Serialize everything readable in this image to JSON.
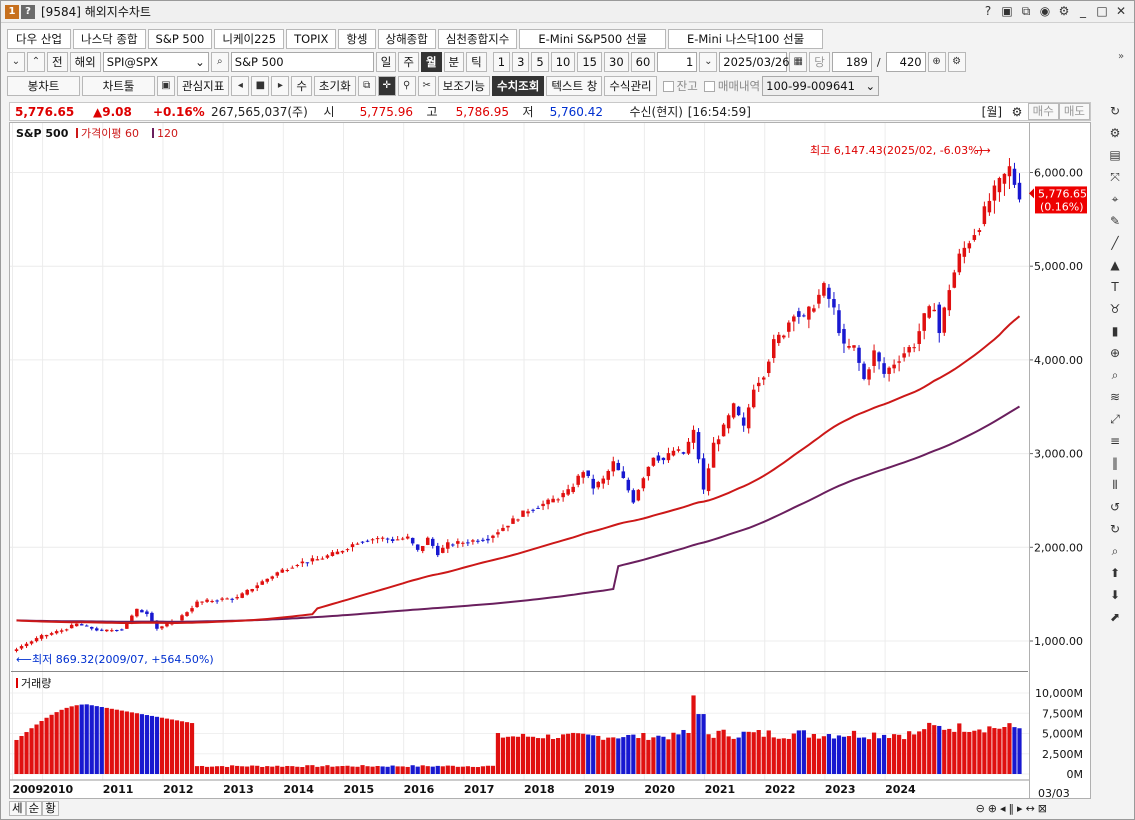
{
  "window": {
    "badge1": "1",
    "badge2": "?",
    "title": "[9584] 해외지수차트",
    "controls": [
      "?",
      "▣",
      "⧉",
      "⚙",
      "⚙",
      "_",
      "□",
      "✕"
    ]
  },
  "index_tabs": [
    "다우 산업",
    "나스닥 종합",
    "S&P 500",
    "니케이225",
    "TOPIX",
    "항셍",
    "상해종합",
    "심천종합지수",
    "E-Mini S&P500 선물",
    "E-Mini 나스닥100 선물"
  ],
  "toolbar1": {
    "prev": "전",
    "region": "해외",
    "symbol": "SPI@SPX",
    "name": "S&P 500",
    "periods": [
      "일",
      "주",
      "월",
      "분",
      "틱"
    ],
    "active_period": "월",
    "minutes": [
      "1",
      "3",
      "5",
      "10",
      "15",
      "30",
      "60"
    ],
    "interval": "1",
    "date": "2025/03/26",
    "dang": "당",
    "count": "189",
    "slash": "/",
    "total": "420"
  },
  "toolbar2": {
    "candle": "봉차트",
    "charttools": "차트툴",
    "indicator": "관심지표",
    "su": "수",
    "reset": "초기화",
    "aux": "보조기능",
    "value_lookup": "수치조회",
    "text_window": "텍스트 창",
    "formula": "수식관리",
    "balance": "잔고",
    "trade_history": "매매내역",
    "account": "100-99-009641"
  },
  "quote": {
    "price": "5,776.65",
    "change": "▲9.08",
    "pct": "+0.16%",
    "volume": "267,565,037(주)",
    "open_label": "시",
    "open": "5,775.96",
    "high_label": "고",
    "high": "5,786.95",
    "low_label": "저",
    "low": "5,760.42",
    "receive": "수신(현지)",
    "time": "[16:54:59]",
    "month_label": "[월]",
    "buy": "매수",
    "sell": "매도"
  },
  "chart_data": {
    "type": "candlestick",
    "title": "S&P 500",
    "legend": [
      "가격이평 60",
      "120"
    ],
    "colors": {
      "up": "#e01010",
      "down": "#1818d0",
      "ma60": "#cc1818",
      "ma120": "#6a1f5e"
    },
    "years": [
      "2009",
      "2010",
      "2011",
      "2012",
      "2013",
      "2014",
      "2015",
      "2016",
      "2017",
      "2018",
      "2019",
      "2020",
      "2021",
      "2022",
      "2023",
      "2024"
    ],
    "y_ticks": [
      "1,000.00",
      "2,000.00",
      "3,000.00",
      "4,000.00",
      "5,000.00",
      "6,000.00"
    ],
    "ylim": [
      870,
      6150
    ],
    "volume_ticks": [
      "0M",
      "2,500M",
      "5,000M",
      "7,500M",
      "10,000M"
    ],
    "high_annotation": "최고 6,147.43(2025/02, -6.03%)",
    "low_annotation": "최저 869.32(2009/07, +564.50%)",
    "last_price": "5,776.65",
    "last_pct": "(0.16%)",
    "volume_title": "거래량",
    "last_date": "03/03",
    "anchors": [
      [
        0,
        920
      ],
      [
        5,
        1050
      ],
      [
        9,
        1115
      ],
      [
        12,
        1180
      ],
      [
        17,
        1105
      ],
      [
        21,
        1130
      ],
      [
        24,
        1330
      ],
      [
        26,
        1300
      ],
      [
        28,
        1135
      ],
      [
        32,
        1220
      ],
      [
        36,
        1410
      ],
      [
        40,
        1440
      ],
      [
        44,
        1460
      ],
      [
        48,
        1600
      ],
      [
        52,
        1730
      ],
      [
        56,
        1830
      ],
      [
        60,
        1870
      ],
      [
        64,
        1945
      ],
      [
        68,
        2060
      ],
      [
        72,
        2100
      ],
      [
        75,
        2080
      ],
      [
        78,
        2100
      ],
      [
        80,
        1960
      ],
      [
        82,
        2090
      ],
      [
        84,
        1940
      ],
      [
        86,
        2030
      ],
      [
        90,
        2060
      ],
      [
        94,
        2100
      ],
      [
        98,
        2250
      ],
      [
        102,
        2400
      ],
      [
        106,
        2480
      ],
      [
        110,
        2590
      ],
      [
        113,
        2820
      ],
      [
        115,
        2640
      ],
      [
        117,
        2720
      ],
      [
        119,
        2900
      ],
      [
        121,
        2720
      ],
      [
        123,
        2500
      ],
      [
        125,
        2760
      ],
      [
        127,
        2980
      ],
      [
        129,
        2930
      ],
      [
        131,
        3030
      ],
      [
        133,
        3000
      ],
      [
        135,
        3230
      ],
      [
        136,
        2950
      ],
      [
        137,
        2600
      ],
      [
        139,
        3100
      ],
      [
        141,
        3270
      ],
      [
        143,
        3500
      ],
      [
        145,
        3270
      ],
      [
        147,
        3720
      ],
      [
        149,
        3860
      ],
      [
        151,
        4180
      ],
      [
        153,
        4300
      ],
      [
        155,
        4520
      ],
      [
        157,
        4430
      ],
      [
        159,
        4600
      ],
      [
        161,
        4770
      ],
      [
        163,
        4530
      ],
      [
        165,
        4130
      ],
      [
        167,
        4130
      ],
      [
        169,
        3790
      ],
      [
        171,
        4080
      ],
      [
        173,
        3850
      ],
      [
        175,
        3970
      ],
      [
        177,
        4080
      ],
      [
        179,
        4170
      ],
      [
        181,
        4450
      ],
      [
        183,
        4590
      ],
      [
        184,
        4290
      ],
      [
        186,
        4770
      ],
      [
        188,
        5100
      ],
      [
        190,
        5280
      ],
      [
        192,
        5450
      ],
      [
        194,
        5700
      ],
      [
        196,
        5880
      ],
      [
        198,
        6040
      ],
      [
        199,
        5890
      ],
      [
        200,
        5770
      ]
    ]
  },
  "bottom": {
    "controls": [
      "세",
      "순",
      "황"
    ],
    "nav": [
      "⊖",
      "⊕",
      "◂",
      "‖",
      "▸",
      "↔",
      "⊠"
    ]
  }
}
